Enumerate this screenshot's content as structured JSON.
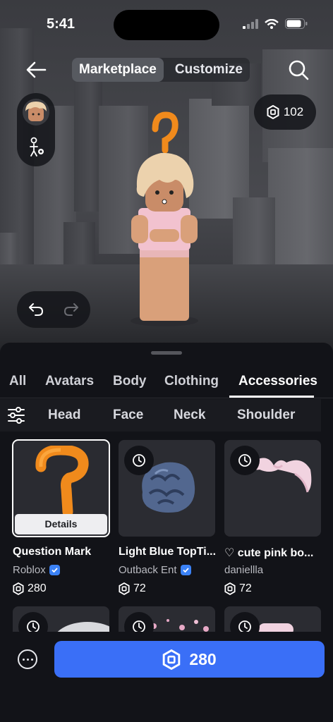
{
  "status_bar": {
    "time": "5:41"
  },
  "top_nav": {
    "tabs": [
      {
        "label": "Marketplace",
        "active": true
      },
      {
        "label": "Customize",
        "active": false
      }
    ]
  },
  "robux_balance": "102",
  "categories": [
    {
      "label": "All",
      "active": false
    },
    {
      "label": "Avatars",
      "active": false
    },
    {
      "label": "Body",
      "active": false
    },
    {
      "label": "Clothing",
      "active": false
    },
    {
      "label": "Accessories",
      "active": true
    }
  ],
  "subcategories": [
    "Head",
    "Face",
    "Neck",
    "Shoulder"
  ],
  "items": [
    {
      "name": "Question Mark",
      "creator": "Roblox",
      "verified": true,
      "price": "280",
      "selected": true,
      "details_label": "Details"
    },
    {
      "name": "Light Blue TopTi...",
      "creator": "Outback Ent",
      "verified": true,
      "price": "72",
      "limited_time": true
    },
    {
      "name": "♡ cute pink bo...",
      "creator": "daniellla",
      "verified": false,
      "price": "72",
      "limited_time": true
    }
  ],
  "buy": {
    "price": "280"
  },
  "colors": {
    "accent_blue": "#3a6ff7",
    "verified_blue": "#3b82f6",
    "question_mark_orange": "#f08a1c"
  },
  "icons": [
    "back-arrow-icon",
    "search-icon",
    "avatar-settings-icon",
    "robux-icon",
    "undo-icon",
    "redo-icon",
    "filter-icon",
    "clock-icon",
    "verified-icon",
    "more-icon"
  ]
}
